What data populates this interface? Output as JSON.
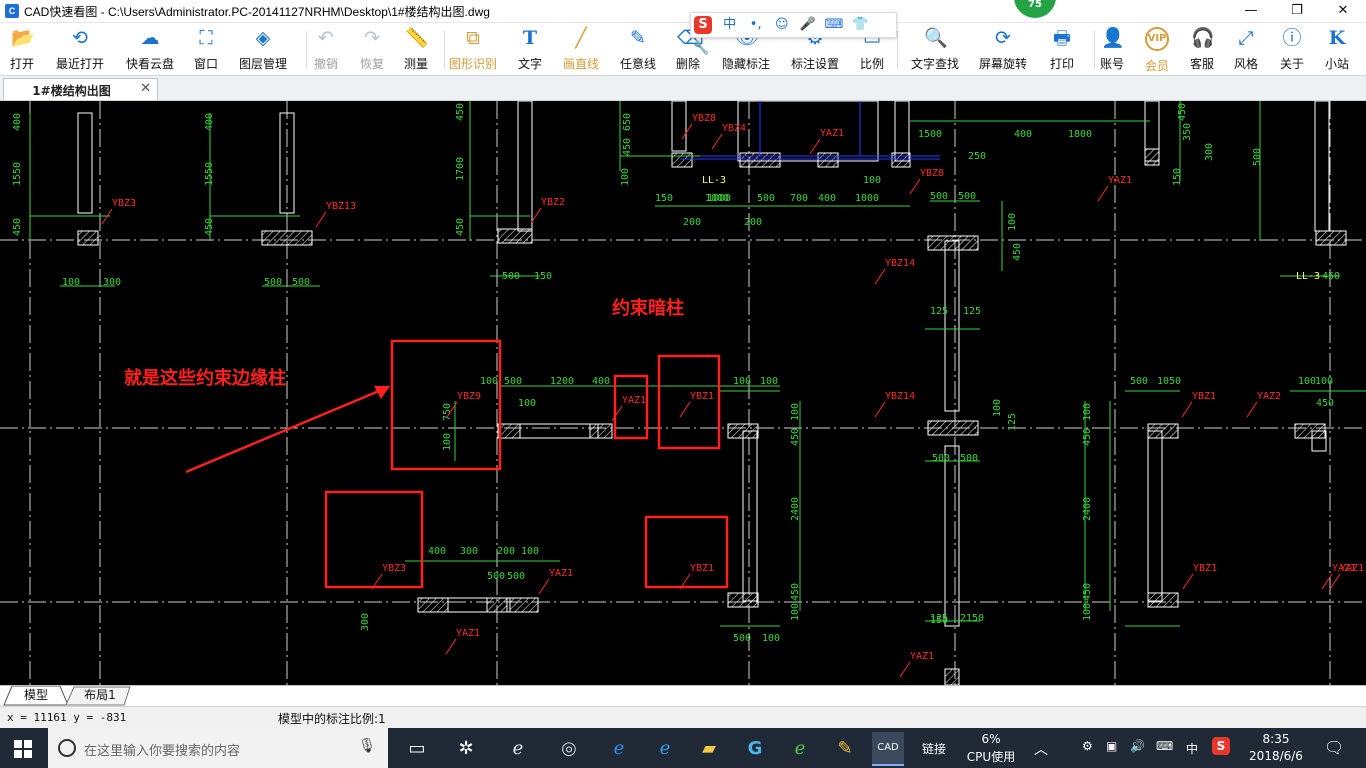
{
  "window": {
    "icon_text": "C",
    "title": "CAD快速看图 - C:\\Users\\Administrator.PC-20141127NRHM\\Desktop\\1#楼结构出图.dwg",
    "minimize": "—",
    "maximize": "❐",
    "close": "✕",
    "badge": "75"
  },
  "ime": {
    "logo": "S",
    "lang": "中",
    "punct": "•,",
    "emoji": "☺",
    "mic": "🎤",
    "keyboard": "⌨",
    "skin": "👕",
    "tool": "🔧"
  },
  "toolbar": [
    {
      "id": "open",
      "label": "打开",
      "icon": "📂",
      "state": "normal"
    },
    {
      "id": "recent",
      "label": "最近打开",
      "icon": "⟲",
      "state": "normal"
    },
    {
      "id": "cloud",
      "label": "快看云盘",
      "icon": "☁",
      "state": "normal"
    },
    {
      "id": "window",
      "label": "窗口",
      "icon": "⛶",
      "state": "normal"
    },
    {
      "id": "layers",
      "label": "图层管理",
      "icon": "◈",
      "state": "normal"
    },
    {
      "id": "undo",
      "label": "撤销",
      "icon": "↶",
      "state": "disabled"
    },
    {
      "id": "redo",
      "label": "恢复",
      "icon": "↷",
      "state": "disabled"
    },
    {
      "id": "measure",
      "label": "测量",
      "icon": "📏",
      "state": "normal"
    },
    {
      "id": "shape",
      "label": "图形识别",
      "icon": "⧉",
      "state": "orange"
    },
    {
      "id": "text",
      "label": "文字",
      "icon": "T",
      "state": "normal"
    },
    {
      "id": "line",
      "label": "画直线",
      "icon": "╱",
      "state": "orange"
    },
    {
      "id": "freeline",
      "label": "任意线",
      "icon": "✎",
      "state": "normal"
    },
    {
      "id": "delete",
      "label": "删除",
      "icon": "⌫",
      "state": "normal"
    },
    {
      "id": "hide",
      "label": "隐藏标注",
      "icon": "👁",
      "state": "normal"
    },
    {
      "id": "dimset",
      "label": "标注设置",
      "icon": "⚙",
      "state": "normal"
    },
    {
      "id": "scale",
      "label": "比例",
      "icon": "▭",
      "state": "normal"
    },
    {
      "id": "find",
      "label": "文字查找",
      "icon": "🔍",
      "state": "normal"
    },
    {
      "id": "rotate",
      "label": "屏幕旋转",
      "icon": "⟳",
      "state": "normal"
    },
    {
      "id": "print",
      "label": "打印",
      "icon": "🖶",
      "state": "normal"
    },
    {
      "id": "account",
      "label": "账号",
      "icon": "👤",
      "state": "normal"
    },
    {
      "id": "vip",
      "label": "会员",
      "icon": "VIP",
      "state": "orange"
    },
    {
      "id": "service",
      "label": "客服",
      "icon": "🎧",
      "state": "normal"
    },
    {
      "id": "style",
      "label": "风格",
      "icon": "⤢",
      "state": "normal"
    },
    {
      "id": "about",
      "label": "关于",
      "icon": "ⓘ",
      "state": "normal"
    },
    {
      "id": "site",
      "label": "小站",
      "icon": "K",
      "state": "normal"
    }
  ],
  "doc_tab": {
    "label": "1#楼结构出图",
    "close": "✕"
  },
  "canvas": {
    "colors": {
      "bg": "#000000",
      "dim": "#39d639",
      "label": "#ff2a2a",
      "wall": "#ffffff",
      "grid": "#cfcfcf",
      "yellow": "#ffff66",
      "annot": "#ff2020",
      "blue": "#2d3aff"
    },
    "annotations": {
      "main_note": "就是这些约束边缘柱",
      "title_note": "约束暗柱"
    },
    "column_labels": [
      {
        "t": "YBZ3"
      },
      {
        "t": "YBZ13"
      },
      {
        "t": "YBZ2"
      },
      {
        "t": "YBZ8"
      },
      {
        "t": "YBZ4"
      },
      {
        "t": "YAZ1"
      },
      {
        "t": "YBZ8"
      },
      {
        "t": "YAZ1"
      },
      {
        "t": "YBZ14"
      },
      {
        "t": "YBZ9"
      },
      {
        "t": "YAZ1"
      },
      {
        "t": "YBZ1"
      },
      {
        "t": "YBZ14"
      },
      {
        "t": "YBZ1"
      },
      {
        "t": "YAZ2"
      },
      {
        "t": "YBZ3"
      },
      {
        "t": "YAZ1"
      },
      {
        "t": "YAZ1"
      },
      {
        "t": "YBZ1"
      },
      {
        "t": "YBZ1"
      },
      {
        "t": "YAZ1"
      },
      {
        "t": "YAZ1"
      },
      {
        "t": "YAZ1"
      }
    ],
    "dims": [
      "400",
      "1550",
      "450",
      "100",
      "300",
      "400",
      "1550",
      "450",
      "500",
      "500",
      "450",
      "1700",
      "450",
      "500",
      "150",
      "650",
      "450",
      "100",
      "LL-3",
      "1000",
      "200",
      "200",
      "1500",
      "400",
      "1800",
      "250",
      "450",
      "350",
      "150",
      "300",
      "150",
      "1000",
      "500",
      "700",
      "400",
      "1000",
      "500",
      "500",
      "100",
      "450",
      "125",
      "125",
      "100",
      "500",
      "1200",
      "400",
      "100",
      "100",
      "500",
      "500",
      "100",
      "100",
      "100",
      "450",
      "2400",
      "450",
      "100",
      "500",
      "100",
      "100",
      "450",
      "2400",
      "450",
      "100",
      "500",
      "1050",
      "100",
      "100",
      "450",
      "750",
      "100",
      "400",
      "300",
      "200",
      "100",
      "300",
      "500",
      "500",
      "125",
      "125",
      "2150",
      "150",
      "500",
      "LL-3",
      "450",
      "100"
    ]
  },
  "layout_tabs": [
    "模型",
    "布局1"
  ],
  "status": {
    "coords": "x = 11161  y = -831",
    "scale": "模型中的标注比例:1"
  },
  "taskbar": {
    "search_placeholder": "在这里输入你要搜索的内容",
    "link": "链接",
    "cpu_percent": "6%",
    "cpu_label": "CPU使用",
    "lang": "中",
    "time": "8:35",
    "date": "2018/6/6"
  }
}
